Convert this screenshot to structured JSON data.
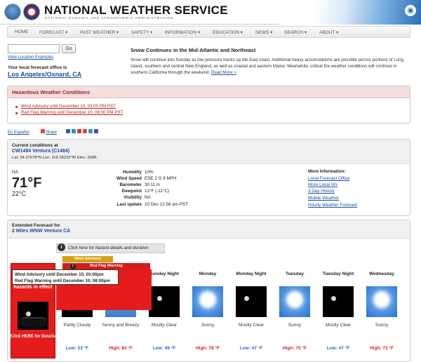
{
  "header": {
    "title": "NATIONAL WEATHER SERVICE",
    "subtitle": "NATIONAL OCEANIC AND ATMOSPHERIC ADMINISTRATION"
  },
  "nav": [
    "HOME",
    "FORECAST ▾",
    "PAST WEATHER ▾",
    "SAFETY ▾",
    "INFORMATION ▾",
    "EDUCATION ▾",
    "NEWS ▾",
    "SEARCH ▾",
    "ABOUT ▾"
  ],
  "location": {
    "input_value": "",
    "go_label": "Go",
    "view_examples": "View Location Examples",
    "office_label": "Your local forecast office is",
    "office_name": "Los Angeles/Oxnard, CA"
  },
  "story": {
    "headline": "Snow Continues in the Mid-Atlantic and Northeast",
    "body": "Snow will continue into Sunday as low pressure tracks up the East coast. Additional heavy accumulations are possible across portions of Long Island, southern and central New England, as well as coastal and eastern Maine. Meanwhile, critical fire weather conditions will continue in southern California through the weekend.",
    "read_more": "Read More >"
  },
  "hazards": {
    "title": "Hazardous Weather Conditions",
    "items": [
      "Wind Advisory until December 10, 03:00 PM PST",
      "Red Flag Warning until December 10, 08:00 PM PST"
    ]
  },
  "social": {
    "espanol": "En Español",
    "share": "Share",
    "colors": [
      "#3b5998",
      "#2a8dd4",
      "#d33",
      "#dd4b39",
      "#3b8dd1",
      "#3b5998"
    ]
  },
  "current": {
    "label": "Current conditions at",
    "station": "CW1484 Ventura (C1484)",
    "coords": "Lat: 34.27678°N  Lon: 119.18332°W  Elev: 269ft.",
    "condition": "NA",
    "temp_f": "71°F",
    "temp_c": "22°C",
    "details": [
      {
        "label": "Humidity",
        "value": "10%"
      },
      {
        "label": "Wind Speed",
        "value": "ESE 2 G 9 MPH"
      },
      {
        "label": "Barometer",
        "value": "30.11 in"
      },
      {
        "label": "Dewpoint",
        "value": "12°F (-11°C)"
      },
      {
        "label": "Visibility",
        "value": "NA"
      },
      {
        "label": "Last update",
        "value": "10 Dec 12:56 am PST"
      }
    ],
    "more_info_title": "More Information:",
    "more_links": [
      "Local Forecast Office",
      "More Local Wx",
      "3 Day History",
      "Mobile Weather",
      "Hourly Weather Forecast"
    ]
  },
  "forecast": {
    "label": "Extended Forecast for",
    "location": "2 Miles WNW Ventura CA",
    "hazard_click": "Click here for hazard details and duration",
    "wind_flag": "Wind Advisory",
    "red_flag": "Red Flag Warning",
    "tooltip_line1": "Wind Advisory until December 10, 03:00pm",
    "tooltip_line2": "Red Flag Warning until December 10, 08:00pm",
    "hazard_in_effect": "hazards in effect",
    "hazard_click_here": "Click HERE for Details",
    "days": [
      {
        "name": "",
        "desc": "Partly Cloudy",
        "temp": "Low: 53 °F",
        "kind": "low",
        "img": "night-cloudy"
      },
      {
        "name": "",
        "desc": "Sunny and Breezy",
        "temp": "High: 83 °F",
        "kind": "high",
        "img": "windsock"
      },
      {
        "name": "Sunday Night",
        "desc": "Mostly Clear",
        "temp": "Low: 49 °F",
        "kind": "low",
        "img": "night"
      },
      {
        "name": "Monday",
        "desc": "Sunny",
        "temp": "High: 78 °F",
        "kind": "high",
        "img": "sunny"
      },
      {
        "name": "Monday Night",
        "desc": "Mostly Clear",
        "temp": "Low: 47 °F",
        "kind": "low",
        "img": "night"
      },
      {
        "name": "Tuesday",
        "desc": "Sunny",
        "temp": "High: 75 °F",
        "kind": "high",
        "img": "sunny"
      },
      {
        "name": "Tuesday Night",
        "desc": "Mostly Clear",
        "temp": "Low: 47 °F",
        "kind": "low",
        "img": "night"
      },
      {
        "name": "Wednesday",
        "desc": "Sunny",
        "temp": "High: 73 °F",
        "kind": "high",
        "img": "sunny"
      }
    ]
  }
}
